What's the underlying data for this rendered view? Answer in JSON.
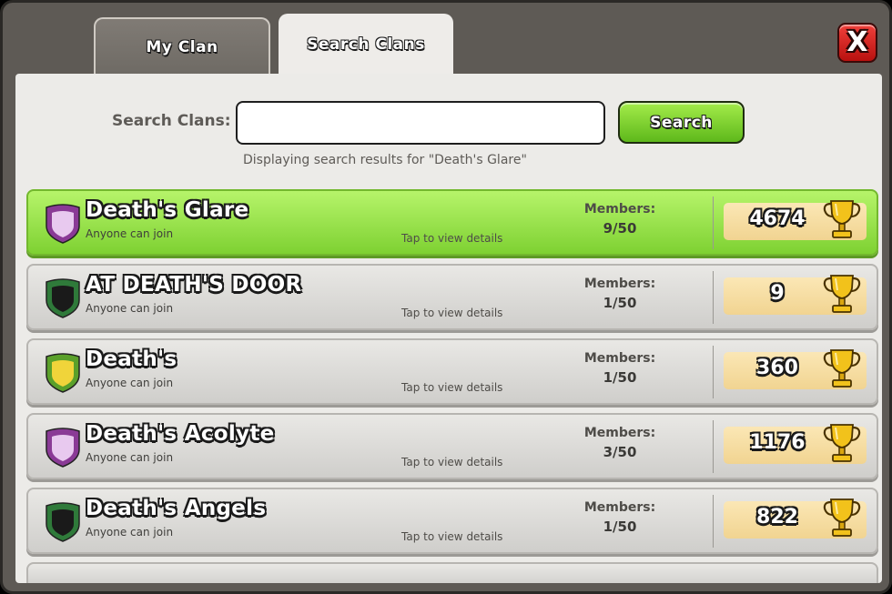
{
  "tabs": {
    "my_clan": "My Clan",
    "search_clans": "Search Clans"
  },
  "close_label": "X",
  "search": {
    "label": "Search Clans:",
    "input_value": "",
    "button_label": "Search",
    "results_note": "Displaying search results for \"Death's Glare\""
  },
  "clans": [
    {
      "name": "Death's Glare",
      "join": "Anyone can join",
      "tap": "Tap to view details",
      "members_label": "Members:",
      "members": "9/50",
      "trophies": "4674",
      "badge_color": "#8a3a96",
      "badge_inner": "#e8c9ef"
    },
    {
      "name": "AT DEATH'S DOOR",
      "join": "Anyone can join",
      "tap": "Tap to view details",
      "members_label": "Members:",
      "members": "1/50",
      "trophies": "9",
      "badge_color": "#2f7a3a",
      "badge_inner": "#1a1a1a"
    },
    {
      "name": "Death's",
      "join": "Anyone can join",
      "tap": "Tap to view details",
      "members_label": "Members:",
      "members": "1/50",
      "trophies": "360",
      "badge_color": "#5aa02a",
      "badge_inner": "#f0d43a"
    },
    {
      "name": "Death's Acolyte",
      "join": "Anyone can join",
      "tap": "Tap to view details",
      "members_label": "Members:",
      "members": "3/50",
      "trophies": "1176",
      "badge_color": "#8a3a96",
      "badge_inner": "#e8c9ef"
    },
    {
      "name": "Death's Angels",
      "join": "Anyone can join",
      "tap": "Tap to view details",
      "members_label": "Members:",
      "members": "1/50",
      "trophies": "822",
      "badge_color": "#2f7a3a",
      "badge_inner": "#1a1a1a"
    }
  ],
  "colors": {
    "highlight_row": "#9be152",
    "search_button": "#7fcf2c",
    "close_button": "#d82420"
  },
  "icons": {
    "close": "close-icon",
    "trophy": "trophy-icon",
    "badge": "clan-badge-icon"
  }
}
